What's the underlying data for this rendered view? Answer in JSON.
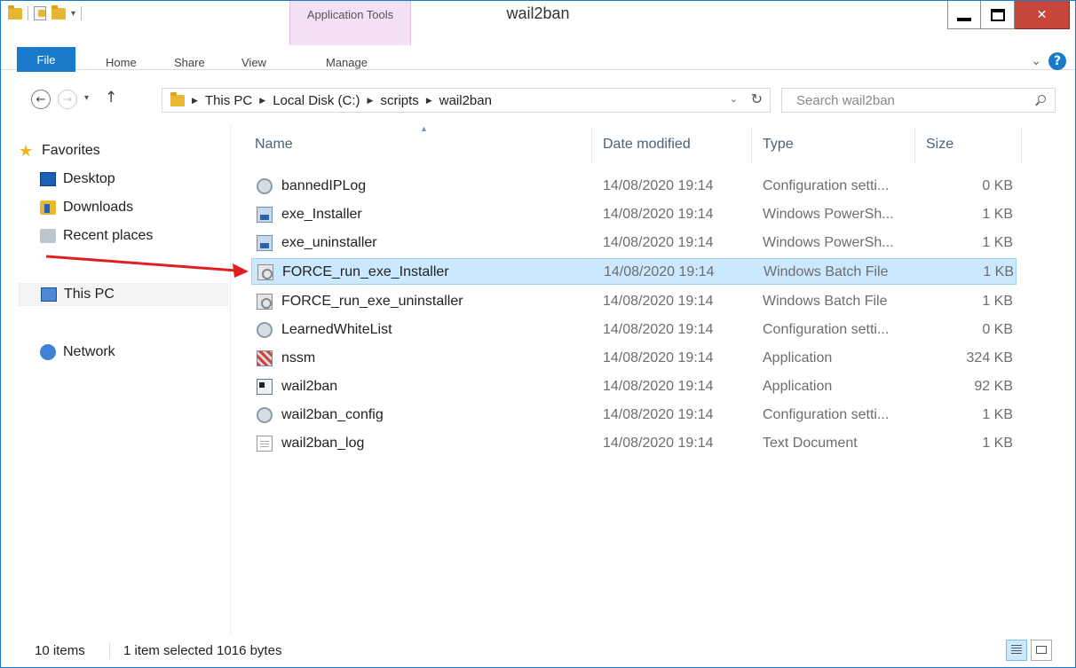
{
  "window": {
    "title": "wail2ban",
    "context_tab_group": "Application Tools"
  },
  "ribbon": {
    "file": "File",
    "tabs": [
      "Home",
      "Share",
      "View",
      "Manage"
    ]
  },
  "address": {
    "crumbs": [
      "This PC",
      "Local Disk (C:)",
      "scripts",
      "wail2ban"
    ]
  },
  "search": {
    "placeholder": "Search wail2ban"
  },
  "navpane": {
    "favorites": "Favorites",
    "desktop": "Desktop",
    "downloads": "Downloads",
    "recent": "Recent places",
    "thispc": "This PC",
    "network": "Network"
  },
  "columns": {
    "name": "Name",
    "date": "Date modified",
    "type": "Type",
    "size": "Size"
  },
  "files": [
    {
      "name": "bannedIPLog",
      "date": "14/08/2020 19:14",
      "type": "Configuration setti...",
      "size": "0 KB",
      "icon": "config-file-icon"
    },
    {
      "name": "exe_Installer",
      "date": "14/08/2020 19:14",
      "type": "Windows PowerSh...",
      "size": "1 KB",
      "icon": "powershell-file-icon"
    },
    {
      "name": "exe_uninstaller",
      "date": "14/08/2020 19:14",
      "type": "Windows PowerSh...",
      "size": "1 KB",
      "icon": "powershell-file-icon"
    },
    {
      "name": "FORCE_run_exe_Installer",
      "date": "14/08/2020 19:14",
      "type": "Windows Batch File",
      "size": "1 KB",
      "icon": "batch-file-icon",
      "selected": true
    },
    {
      "name": "FORCE_run_exe_uninstaller",
      "date": "14/08/2020 19:14",
      "type": "Windows Batch File",
      "size": "1 KB",
      "icon": "batch-file-icon"
    },
    {
      "name": "LearnedWhiteList",
      "date": "14/08/2020 19:14",
      "type": "Configuration setti...",
      "size": "0 KB",
      "icon": "config-file-icon"
    },
    {
      "name": "nssm",
      "date": "14/08/2020 19:14",
      "type": "Application",
      "size": "324 KB",
      "icon": "nssm-app-icon"
    },
    {
      "name": "wail2ban",
      "date": "14/08/2020 19:14",
      "type": "Application",
      "size": "92 KB",
      "icon": "application-icon"
    },
    {
      "name": "wail2ban_config",
      "date": "14/08/2020 19:14",
      "type": "Configuration setti...",
      "size": "1 KB",
      "icon": "config-file-icon"
    },
    {
      "name": "wail2ban_log",
      "date": "14/08/2020 19:14",
      "type": "Text Document",
      "size": "1 KB",
      "icon": "text-file-icon"
    }
  ],
  "status": {
    "count": "10 items",
    "selection": "1 item selected 1016 bytes"
  },
  "colors": {
    "accent": "#1979ca",
    "selection": "#cce8ff",
    "context_tab": "#f5e1f5",
    "close_button": "#c7463c",
    "annotation_arrow": "#e02020"
  }
}
